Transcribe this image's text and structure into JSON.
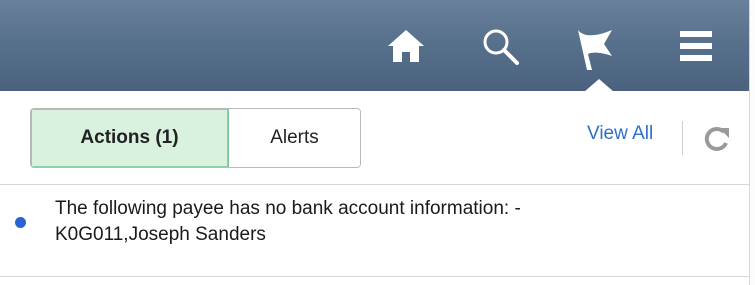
{
  "header": {
    "icons": [
      "home-icon",
      "search-icon",
      "flag-icon",
      "menu-icon"
    ],
    "background": "#566f8a"
  },
  "tabs": [
    {
      "label": "Actions (1)",
      "active": true
    },
    {
      "label": "Alerts",
      "active": false
    }
  ],
  "toolbar": {
    "view_all_label": "View All",
    "refresh_icon": "refresh-icon"
  },
  "notifications": [
    {
      "line1": "The following payee has no bank account information: -",
      "line2": "K0G011,Joseph Sanders",
      "unread": true
    }
  ],
  "colors": {
    "active_tab_bg": "#d9f1df",
    "link": "#2f6fc4",
    "unread_dot": "#2b62d2"
  }
}
